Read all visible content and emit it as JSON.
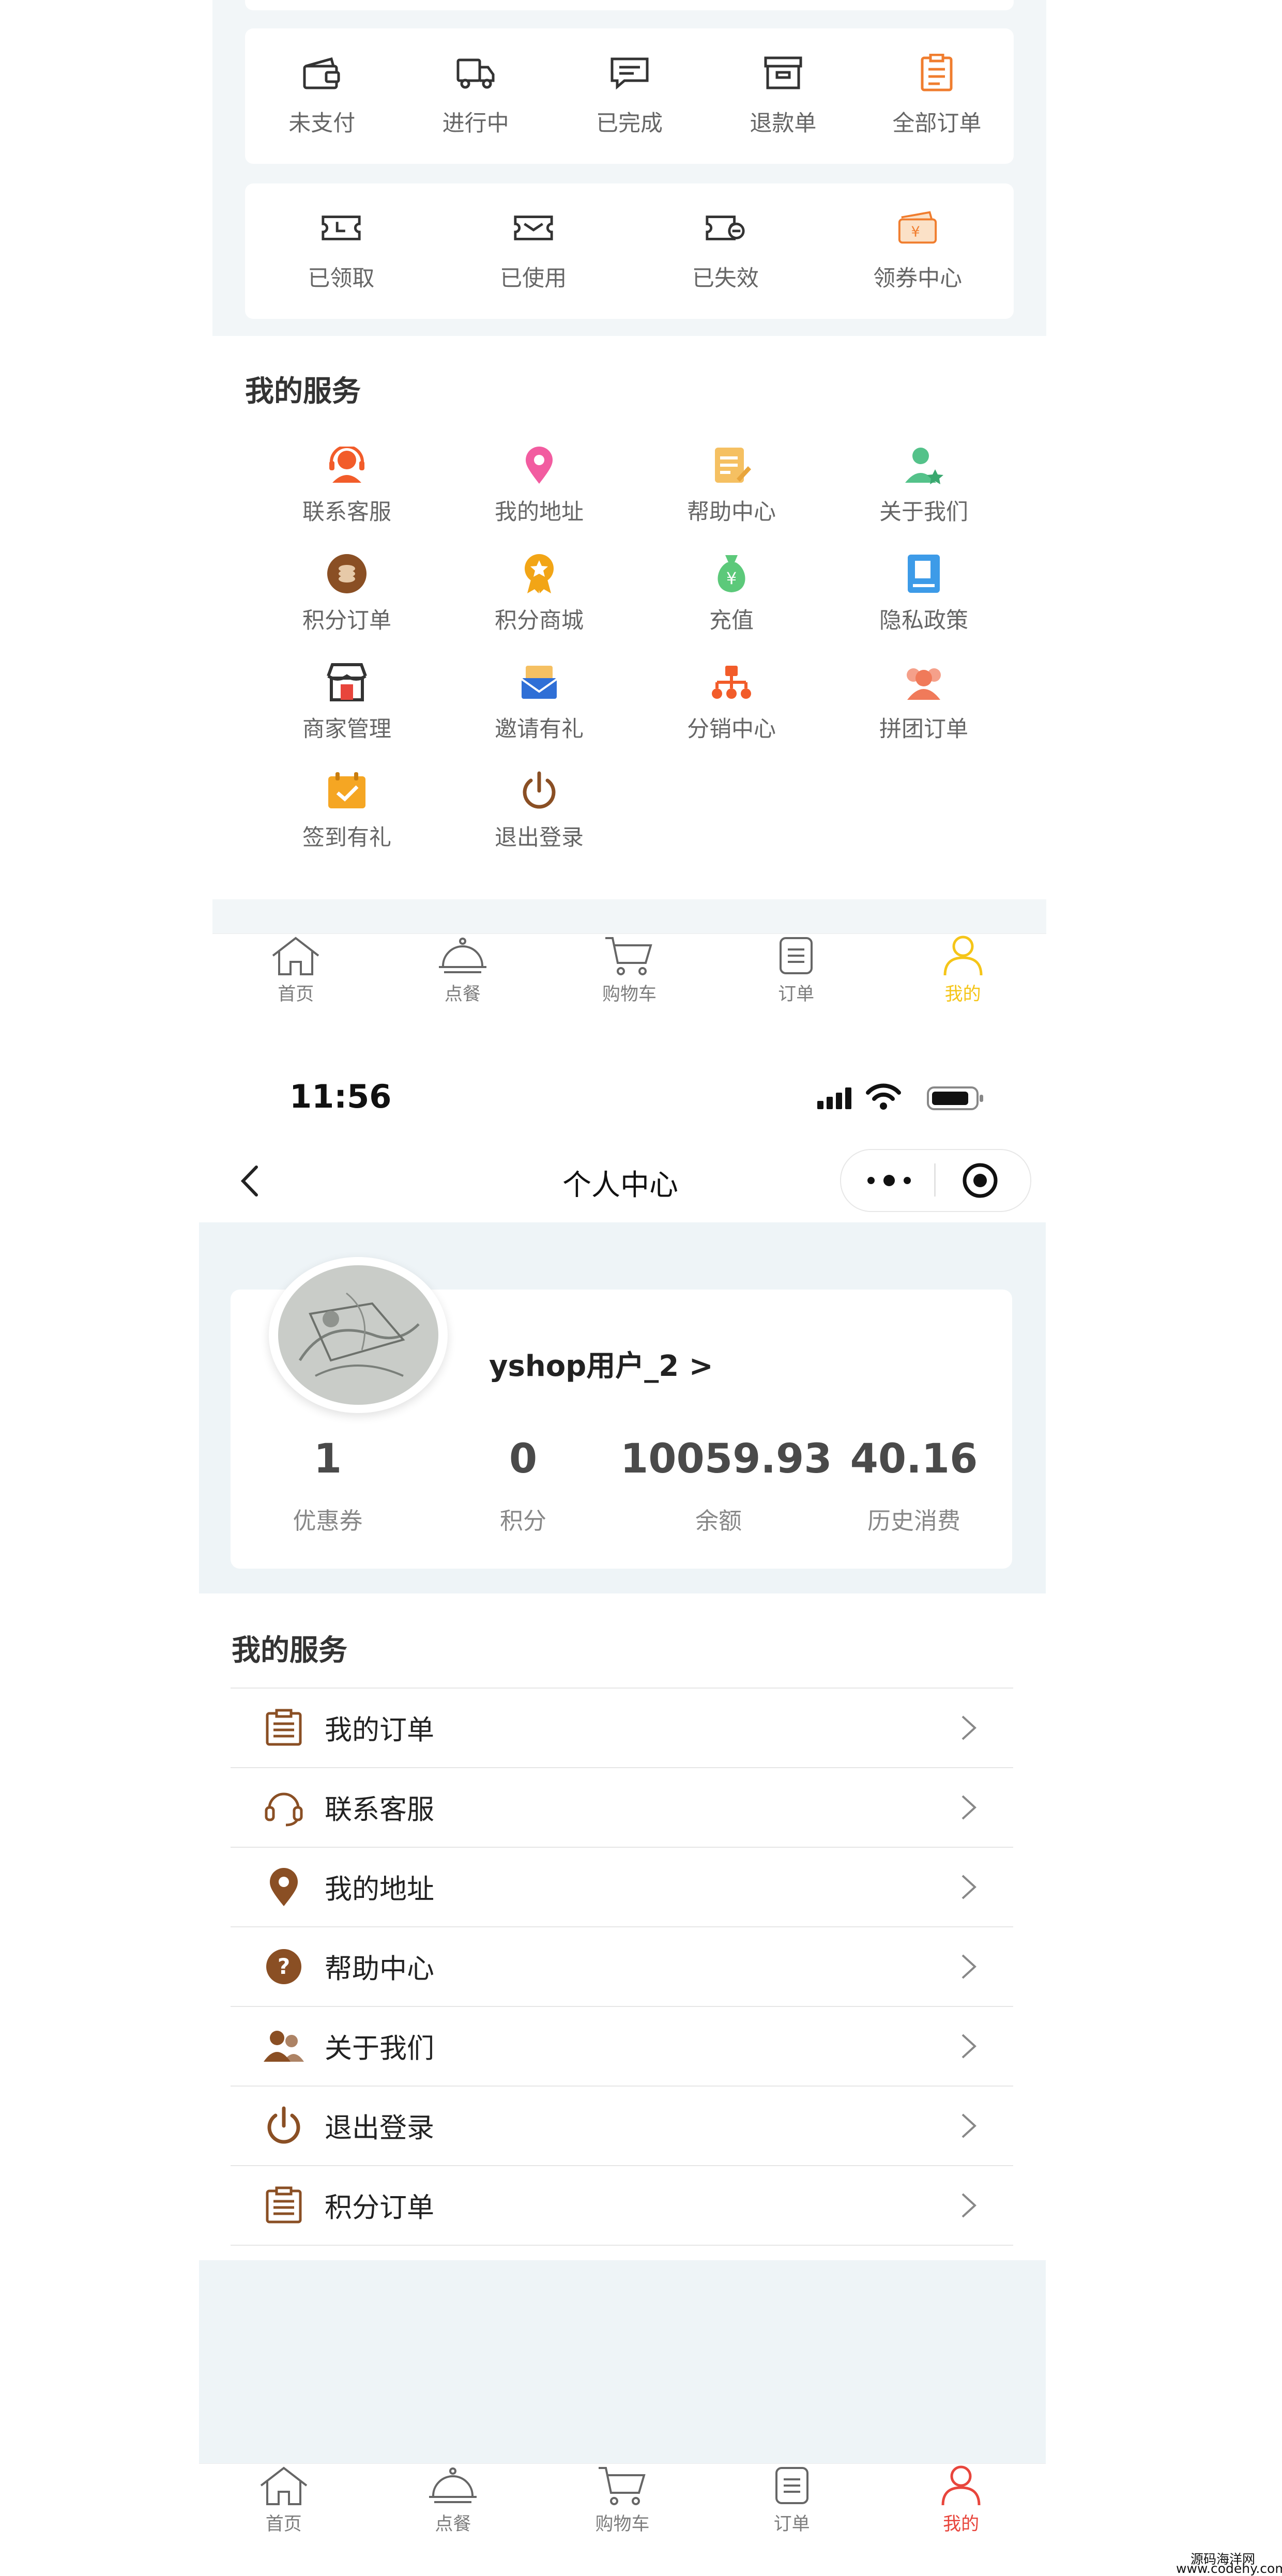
{
  "screen_a": {
    "order_tabs": [
      {
        "label": "未支付",
        "icon": "wallet-icon"
      },
      {
        "label": "进行中",
        "icon": "truck-icon"
      },
      {
        "label": "已完成",
        "icon": "message-icon"
      },
      {
        "label": "退款单",
        "icon": "archive-icon"
      },
      {
        "label": "全部订单",
        "icon": "clipboard-icon"
      }
    ],
    "coupon_tabs": [
      {
        "label": "已领取",
        "icon": "ticket-icon"
      },
      {
        "label": "已使用",
        "icon": "ticket-used-icon"
      },
      {
        "label": "已失效",
        "icon": "ticket-expired-icon"
      },
      {
        "label": "领券中心",
        "icon": "coupon-center-icon"
      }
    ],
    "services_title": "我的服务",
    "services": [
      {
        "label": "联系客服",
        "icon": "customer-service-icon",
        "color": "#f25c2a"
      },
      {
        "label": "我的地址",
        "icon": "location-pin-icon",
        "color": "#f25ca0"
      },
      {
        "label": "帮助中心",
        "icon": "help-document-icon",
        "color": "#f5c062"
      },
      {
        "label": "关于我们",
        "icon": "about-user-icon",
        "color": "#54c28a"
      },
      {
        "label": "积分订单",
        "icon": "points-coin-icon",
        "color": "#8a4f24"
      },
      {
        "label": "积分商城",
        "icon": "medal-icon",
        "color": "#f2a516"
      },
      {
        "label": "充值",
        "icon": "money-bag-icon",
        "color": "#5cc97a"
      },
      {
        "label": "隐私政策",
        "icon": "privacy-book-icon",
        "color": "#3d9be8"
      },
      {
        "label": "商家管理",
        "icon": "store-icon",
        "color": "#333333"
      },
      {
        "label": "邀请有礼",
        "icon": "invite-envelope-icon",
        "color": "#2f6fd6"
      },
      {
        "label": "分销中心",
        "icon": "distribution-icon",
        "color": "#f25c2a"
      },
      {
        "label": "拼团订单",
        "icon": "group-users-icon",
        "color": "#f07a5a"
      },
      {
        "label": "签到有礼",
        "icon": "calendar-check-icon",
        "color": "#f5a623"
      },
      {
        "label": "退出登录",
        "icon": "power-icon",
        "color": "#8a4f24"
      }
    ],
    "tabbar": [
      {
        "label": "首页",
        "icon": "home-icon",
        "active": false
      },
      {
        "label": "点餐",
        "icon": "dish-cover-icon",
        "active": false
      },
      {
        "label": "购物车",
        "icon": "cart-icon",
        "active": false
      },
      {
        "label": "订单",
        "icon": "order-list-icon",
        "active": false
      },
      {
        "label": "我的",
        "icon": "user-icon",
        "active": true
      }
    ],
    "tab_active_color": "#f5c518"
  },
  "screen_b": {
    "status_time": "11:56",
    "nav_title": "个人中心",
    "user_name": "yshop用户_2 >",
    "stats": [
      {
        "value": "1",
        "label": "优惠券"
      },
      {
        "value": "0",
        "label": "积分"
      },
      {
        "value": "10059.93",
        "label": "余额"
      },
      {
        "value": "40.16",
        "label": "历史消费"
      }
    ],
    "services_title": "我的服务",
    "services": [
      {
        "label": "我的订单",
        "icon": "order-list-icon"
      },
      {
        "label": "联系客服",
        "icon": "headset-icon"
      },
      {
        "label": "我的地址",
        "icon": "location-pin-icon"
      },
      {
        "label": "帮助中心",
        "icon": "question-icon"
      },
      {
        "label": "关于我们",
        "icon": "users-icon"
      },
      {
        "label": "退出登录",
        "icon": "power-icon"
      },
      {
        "label": "积分订单",
        "icon": "order-list-icon"
      }
    ],
    "tabbar": [
      {
        "label": "首页",
        "icon": "home-icon",
        "active": false
      },
      {
        "label": "点餐",
        "icon": "dish-cover-icon",
        "active": false
      },
      {
        "label": "购物车",
        "icon": "cart-icon",
        "active": false
      },
      {
        "label": "订单",
        "icon": "order-list-icon",
        "active": false
      },
      {
        "label": "我的",
        "icon": "user-icon",
        "active": true
      }
    ],
    "tab_active_color": "#e8453c",
    "accent_brown": "#8a4f24"
  },
  "watermark": {
    "line1": "源码海洋网",
    "line2": "www.codehy.com"
  }
}
